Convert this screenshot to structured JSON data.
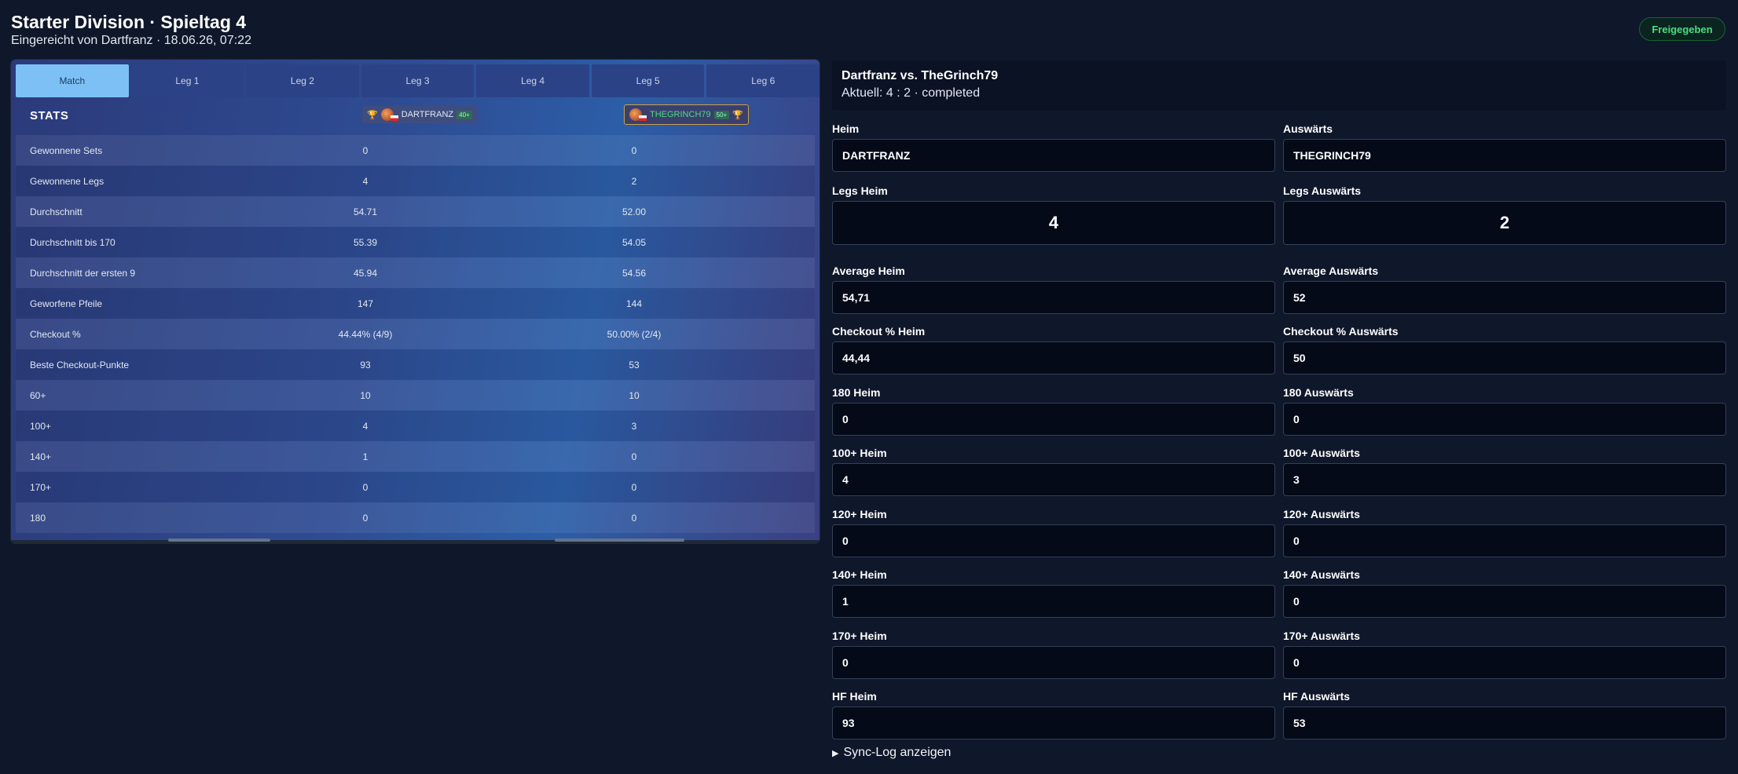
{
  "header": {
    "title": "Starter Division · Spieltag 4",
    "subtitle": "Eingereicht von Dartfranz · 18.06.26, 07:22",
    "status_badge": "Freigegeben"
  },
  "stats_panel": {
    "tabs": [
      "Match",
      "Leg 1",
      "Leg 2",
      "Leg 3",
      "Leg 4",
      "Leg 5",
      "Leg 6"
    ],
    "active_tab": "Match",
    "stats_label": "STATS",
    "home_player": {
      "name": "DARTFRANZ",
      "badge": "40+"
    },
    "away_player": {
      "name": "THEGRINCH79",
      "badge": "50+"
    },
    "rows": [
      {
        "label": "Gewonnene Sets",
        "home": "0",
        "away": "0"
      },
      {
        "label": "Gewonnene Legs",
        "home": "4",
        "away": "2"
      },
      {
        "label": "Durchschnitt",
        "home": "54.71",
        "away": "52.00"
      },
      {
        "label": "Durchschnitt bis 170",
        "home": "55.39",
        "away": "54.05"
      },
      {
        "label": "Durchschnitt der ersten 9",
        "home": "45.94",
        "away": "54.56"
      },
      {
        "label": "Geworfene Pfeile",
        "home": "147",
        "away": "144"
      },
      {
        "label": "Checkout %",
        "home": "44.44% (4/9)",
        "away": "50.00% (2/4)"
      },
      {
        "label": "Beste Checkout-Punkte",
        "home": "93",
        "away": "53"
      },
      {
        "label": "60+",
        "home": "10",
        "away": "10"
      },
      {
        "label": "100+",
        "home": "4",
        "away": "3"
      },
      {
        "label": "140+",
        "home": "1",
        "away": "0"
      },
      {
        "label": "170+",
        "home": "0",
        "away": "0"
      },
      {
        "label": "180",
        "home": "0",
        "away": "0"
      }
    ]
  },
  "summary": {
    "title": "Dartfranz vs. TheGrinch79",
    "status": "Aktuell: 4 : 2 · completed"
  },
  "form": {
    "fields": [
      {
        "label": "Heim",
        "value": "DARTFRANZ"
      },
      {
        "label": "Auswärts",
        "value": "THEGRINCH79"
      },
      {
        "label": "Legs Heim",
        "value": "4"
      },
      {
        "label": "Legs Auswärts",
        "value": "2"
      },
      {
        "label": "Average Heim",
        "value": "54,71"
      },
      {
        "label": "Average Auswärts",
        "value": "52"
      },
      {
        "label": "Checkout % Heim",
        "value": "44,44"
      },
      {
        "label": "Checkout % Auswärts",
        "value": "50"
      },
      {
        "label": "180 Heim",
        "value": "0"
      },
      {
        "label": "180 Auswärts",
        "value": "0"
      },
      {
        "label": "100+ Heim",
        "value": "4"
      },
      {
        "label": "100+ Auswärts",
        "value": "3"
      },
      {
        "label": "120+ Heim",
        "value": "0"
      },
      {
        "label": "120+ Auswärts",
        "value": "0"
      },
      {
        "label": "140+ Heim",
        "value": "1"
      },
      {
        "label": "140+ Auswärts",
        "value": "0"
      },
      {
        "label": "170+ Heim",
        "value": "0"
      },
      {
        "label": "170+ Auswärts",
        "value": "0"
      },
      {
        "label": "HF Heim",
        "value": "93"
      },
      {
        "label": "HF Auswärts",
        "value": "53"
      }
    ]
  },
  "sync_log": {
    "label": "Sync-Log anzeigen"
  },
  "colors": {
    "accent_tab": "#7dc0f5",
    "badge_green": "#4ade80",
    "input_bg": "#040a18"
  }
}
